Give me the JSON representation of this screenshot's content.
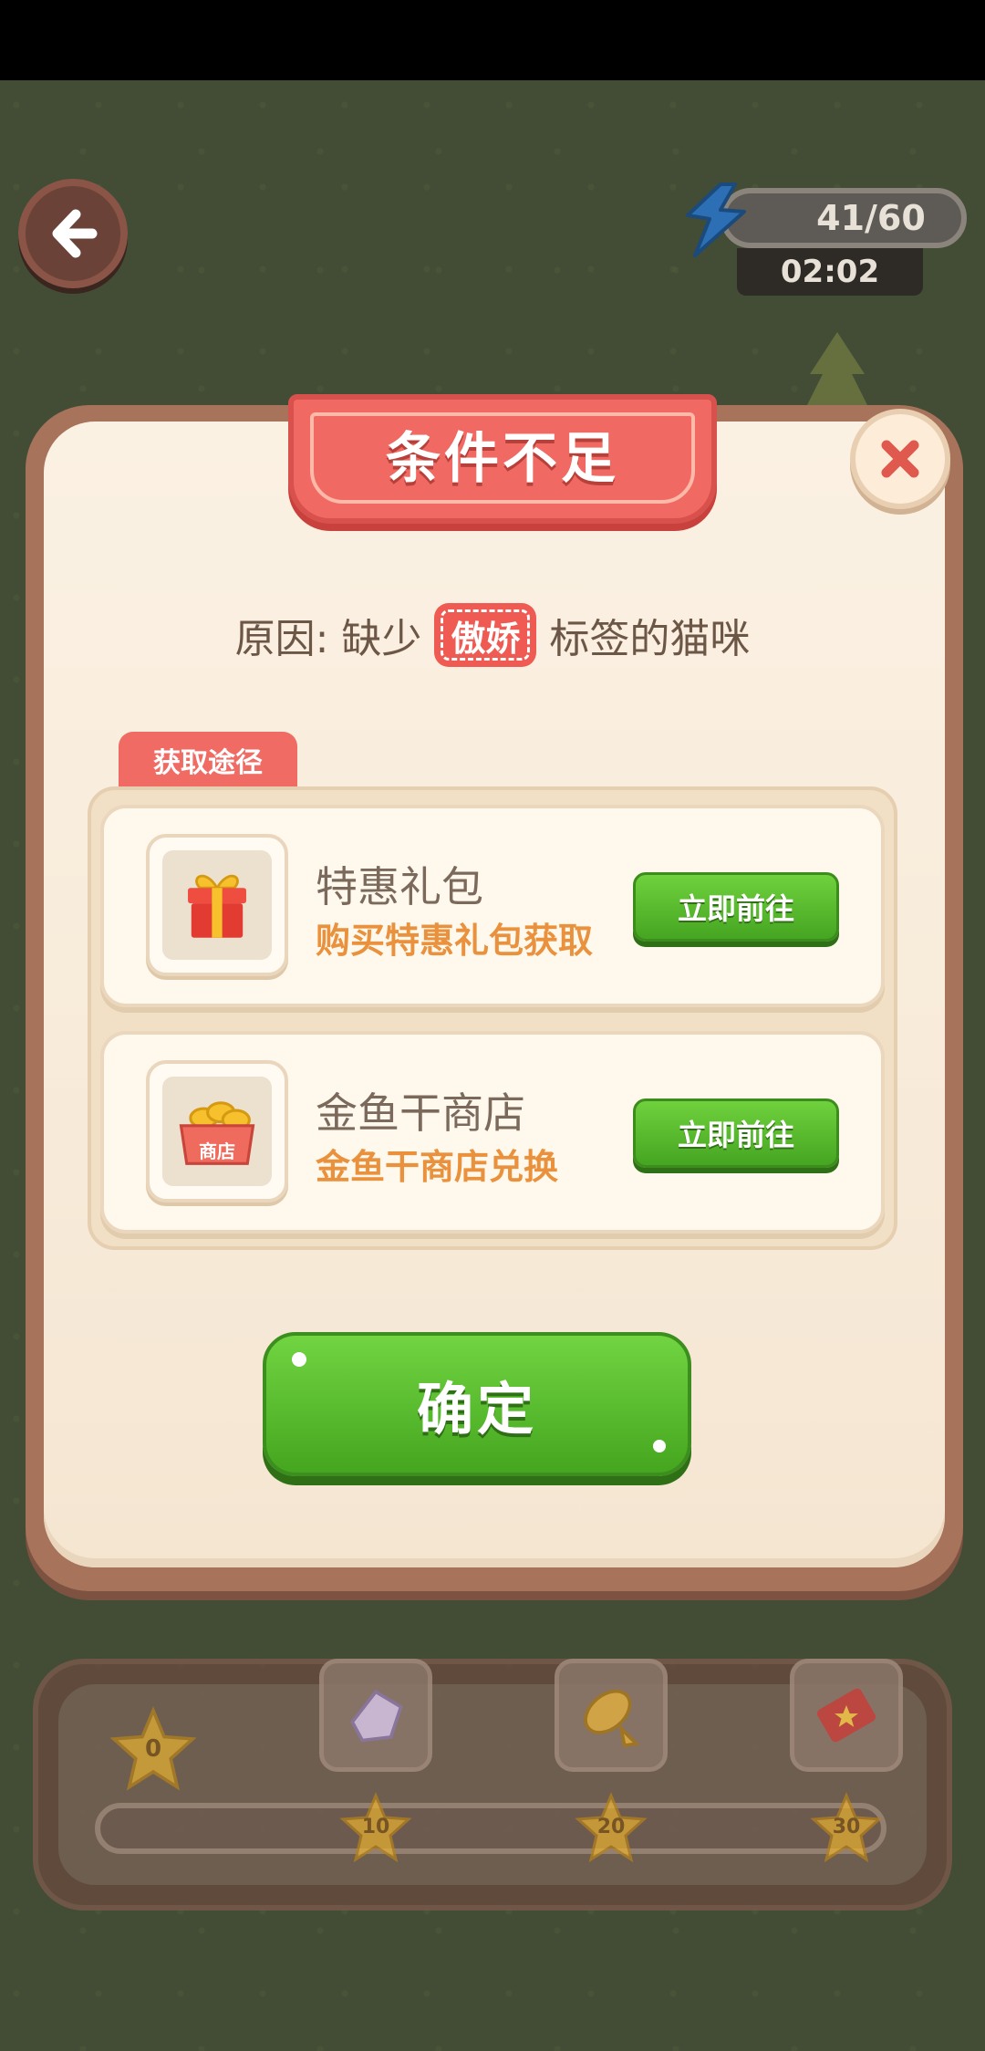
{
  "hud": {
    "back_icon": "arrow-left-icon",
    "energy_icon": "lightning-bolt-icon",
    "energy": "41/60",
    "timer": "02:02"
  },
  "dialog": {
    "title": "条件不足",
    "close_icon": "close-icon",
    "reason_prefix": "原因: 缺少",
    "reason_tag": "傲娇",
    "reason_suffix": "标签的猫咪",
    "sources_tab": "获取途径",
    "sources": [
      {
        "icon": "gift-box-icon",
        "title": "特惠礼包",
        "subtitle": "购买特惠礼包获取",
        "button": "立即前往"
      },
      {
        "icon": "fish-shop-basket-icon",
        "icon_label": "商店",
        "title": "金鱼干商店",
        "subtitle": "金鱼干商店兑换",
        "button": "立即前往"
      }
    ],
    "confirm": "确定"
  },
  "rewards": {
    "star_current": "0",
    "milestones": [
      "10",
      "20",
      "30"
    ],
    "items": [
      "gem-icon",
      "fish-icon",
      "ticket-icon"
    ]
  },
  "colors": {
    "title_red": "#f06a63",
    "button_green": "#52b52b",
    "subtitle_orange": "#e9913c",
    "panel_cream": "#fbf1e3"
  }
}
